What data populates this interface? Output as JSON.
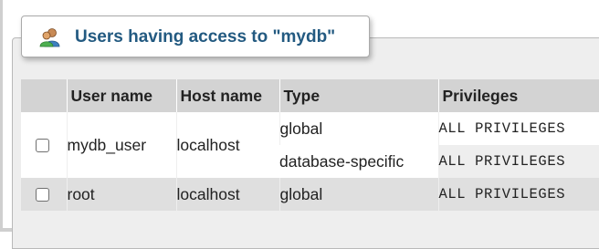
{
  "panel": {
    "title": "Users having access to \"mydb\"",
    "icon": "users-icon"
  },
  "table": {
    "headers": {
      "user_name": "User name",
      "host_name": "Host name",
      "type": "Type",
      "privileges": "Privileges"
    },
    "rows": [
      {
        "user": "mydb_user",
        "host": "localhost",
        "checked": false,
        "grants": [
          {
            "type": "global",
            "privileges": "ALL PRIVILEGES"
          },
          {
            "type": "database-specific",
            "privileges": "ALL PRIVILEGES"
          }
        ]
      },
      {
        "user": "root",
        "host": "localhost",
        "checked": false,
        "grants": [
          {
            "type": "global",
            "privileges": "ALL PRIVILEGES"
          }
        ]
      }
    ]
  },
  "colors": {
    "title": "#235a81",
    "header_bg": "#d3d3d3",
    "row_light": "#ffffff",
    "row_alt": "#eeeeee",
    "row_dark": "#dfdfdf"
  }
}
